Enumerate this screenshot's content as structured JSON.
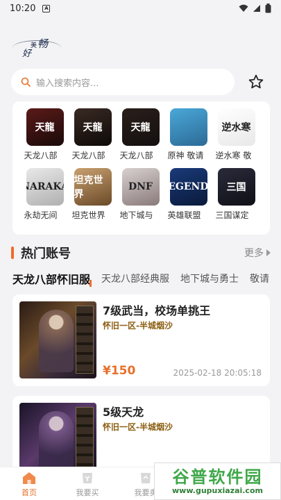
{
  "status_bar": {
    "time": "10:20",
    "app_indicator": "A"
  },
  "logo": {
    "text_a": "好",
    "text_b": "美",
    "text_c": "畅"
  },
  "search": {
    "placeholder": "输入搜索内容..."
  },
  "games": [
    {
      "name": "天龙八部",
      "art": "天龍",
      "colors": [
        "#5a1a18",
        "#1a0a0a"
      ]
    },
    {
      "name": "天龙八部",
      "art": "天龍",
      "colors": [
        "#3a2a24",
        "#0e0a08"
      ]
    },
    {
      "name": "天龙八部",
      "art": "天龍",
      "colors": [
        "#2a1e1a",
        "#141010"
      ]
    },
    {
      "name": "原神 敬请",
      "art": "",
      "colors": [
        "#4aa8d8",
        "#2c6a96"
      ]
    },
    {
      "name": "逆水寒 敬",
      "art": "逆水寒",
      "colors": [
        "#ffffff",
        "#e8e8e8"
      ]
    },
    {
      "name": "永劫无间",
      "art": "NARAKA",
      "colors": [
        "#e8e8e8",
        "#b0b0b0"
      ]
    },
    {
      "name": "坦克世界",
      "art": "坦克世界",
      "colors": [
        "#c8a070",
        "#6a4a28"
      ]
    },
    {
      "name": "地下城与",
      "art": "DNF",
      "colors": [
        "#d8d0d0",
        "#8a7a7a"
      ]
    },
    {
      "name": "英雄联盟",
      "art": "LEGENDS",
      "colors": [
        "#1a3a7a",
        "#0a1a3a"
      ]
    },
    {
      "name": "三国谋定",
      "art": "三国",
      "colors": [
        "#2a2a3a",
        "#101018"
      ]
    }
  ],
  "hot_section": {
    "title": "热门账号",
    "more": "更多"
  },
  "tabs": [
    "天龙八部怀旧服",
    "天龙八部经典服",
    "地下城与勇士",
    "敬请"
  ],
  "listings": [
    {
      "title": "7级武当，校场单挑王",
      "server": "怀旧一区-半城烟沙",
      "price": "¥150",
      "date": "2025-02-18 20:05:18"
    },
    {
      "title": "5级天龙",
      "server": "怀旧一区-半城烟沙",
      "price": "",
      "date": ""
    }
  ],
  "bottom_nav": [
    {
      "label": "首页",
      "icon": "home-icon",
      "active": true
    },
    {
      "label": "我要买",
      "icon": "buy-icon",
      "active": false
    },
    {
      "label": "我要卖",
      "icon": "sell-icon",
      "active": false
    }
  ],
  "watermark": {
    "main": "谷普软件园",
    "url": "www.gupuxiazai.com"
  },
  "colors": {
    "accent": "#e6702b",
    "server_text": "#8b5e12",
    "background": "#f3f3f5"
  }
}
